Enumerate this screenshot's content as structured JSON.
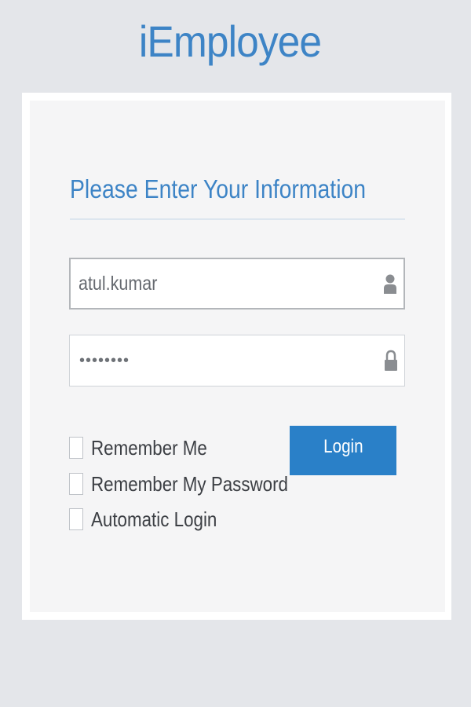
{
  "app": {
    "title": "iEmployee"
  },
  "login_form": {
    "heading": "Please Enter Your Information",
    "username": {
      "value": "atul.kumar",
      "icon": "user-icon"
    },
    "password": {
      "value": "••••••••",
      "icon": "lock-icon"
    },
    "options": [
      {
        "label": "Remember Me",
        "checked": false
      },
      {
        "label": "Remember My Password",
        "checked": false
      },
      {
        "label": "Automatic Login",
        "checked": false
      }
    ],
    "login_label": "Login"
  },
  "colors": {
    "accent": "#3d84c6",
    "button": "#2a80c8",
    "page_background": "#e4e6ea"
  }
}
